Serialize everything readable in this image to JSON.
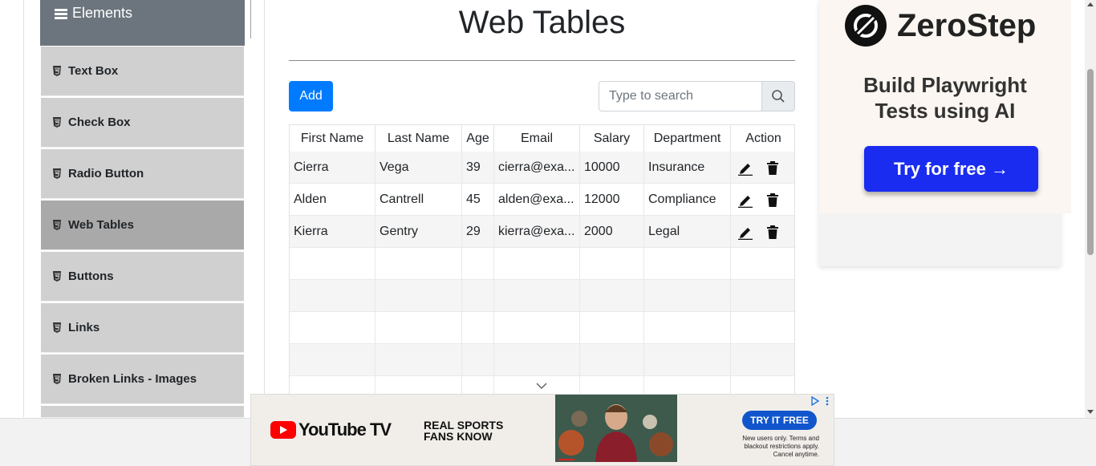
{
  "sidebar": {
    "group_title": "Elements",
    "items": [
      {
        "label": "Text Box"
      },
      {
        "label": "Check Box"
      },
      {
        "label": "Radio Button"
      },
      {
        "label": "Web Tables",
        "active": true
      },
      {
        "label": "Buttons"
      },
      {
        "label": "Links"
      },
      {
        "label": "Broken Links - Images"
      }
    ]
  },
  "main": {
    "title": "Web Tables",
    "add_label": "Add",
    "search_placeholder": "Type to search"
  },
  "table": {
    "columns": [
      "First Name",
      "Last Name",
      "Age",
      "Email",
      "Salary",
      "Department",
      "Action"
    ],
    "rows": [
      {
        "first": "Cierra",
        "last": "Vega",
        "age": "39",
        "email": "cierra@exa...",
        "salary": "10000",
        "dept": "Insurance"
      },
      {
        "first": "Alden",
        "last": "Cantrell",
        "age": "45",
        "email": "alden@exa...",
        "salary": "12000",
        "dept": "Compliance"
      },
      {
        "first": "Kierra",
        "last": "Gentry",
        "age": "29",
        "email": "kierra@exa...",
        "salary": "2000",
        "dept": "Legal"
      }
    ]
  },
  "ad_right": {
    "brand": "ZeroStep",
    "tagline_line1": "Build Playwright",
    "tagline_line2": "Tests using AI",
    "cta": "Try for free →",
    "cta_color": "#1a2cf0"
  },
  "ad_bottom": {
    "brand": "YouTube TV",
    "msg_line1": "REAL SPORTS",
    "msg_line2": "FANS KNOW",
    "cta": "TRY IT FREE",
    "fine1": "New users only. Terms and",
    "fine2": "blackout restrictions apply.",
    "fine3": "Cancel anytime."
  },
  "colors": {
    "accent": "#007bff",
    "sidebar_header": "#6c757d",
    "sidebar_item": "#d0d0d0",
    "sidebar_active": "#a9a9a9"
  }
}
